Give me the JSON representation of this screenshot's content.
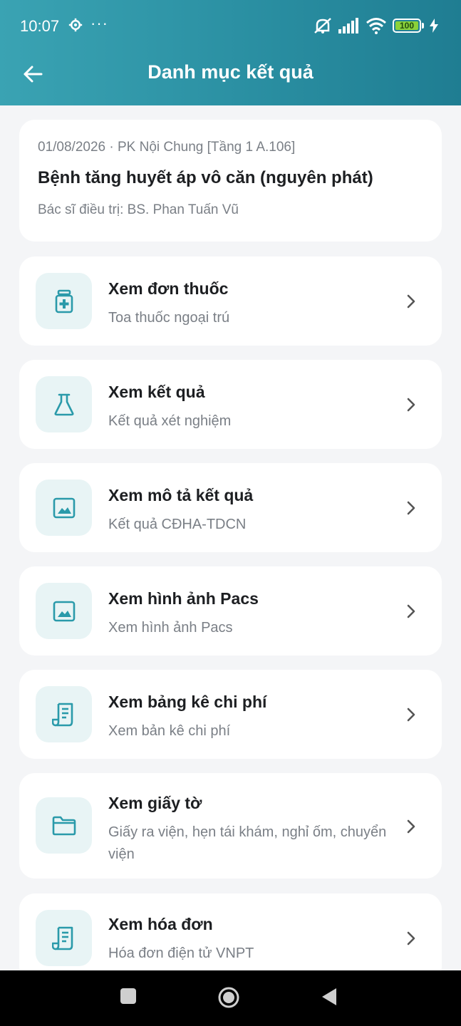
{
  "status": {
    "time": "10:07",
    "dots": "···",
    "battery": "100"
  },
  "header": {
    "title": "Danh mục kết quả"
  },
  "visit": {
    "meta": "01/08/2026 · PK Nội Chung [Tầng 1  A.106]",
    "diagnosis": "Bệnh tăng huyết áp vô căn (nguyên phát)",
    "doctor": "Bác sĩ điều trị: BS. Phan Tuấn Vũ"
  },
  "menu": [
    {
      "title": "Xem đơn thuốc",
      "subtitle": "Toa thuốc ngoại trú",
      "icon": "medicine-bottle-icon"
    },
    {
      "title": "Xem kết quả",
      "subtitle": "Kết quả xét nghiệm",
      "icon": "flask-icon"
    },
    {
      "title": "Xem mô tả kết quả",
      "subtitle": "Kết quả CĐHA-TDCN",
      "icon": "image-icon"
    },
    {
      "title": "Xem hình ảnh Pacs",
      "subtitle": "Xem hình ảnh Pacs",
      "icon": "image-icon"
    },
    {
      "title": "Xem bảng kê chi phí",
      "subtitle": "Xem bản kê chi phí",
      "icon": "receipt-icon"
    },
    {
      "title": "Xem giấy tờ",
      "subtitle": "Giấy ra viện, hẹn tái khám, nghỉ ốm, chuyển viện",
      "icon": "folder-icon"
    },
    {
      "title": "Xem hóa đơn",
      "subtitle": "Hóa đơn điện tử VNPT",
      "icon": "receipt-icon"
    }
  ],
  "colors": {
    "header_start": "#3aa3b3",
    "header_end": "#1f7d92",
    "accent": "#2a9aaa",
    "icon_bg": "#e8f4f5"
  }
}
